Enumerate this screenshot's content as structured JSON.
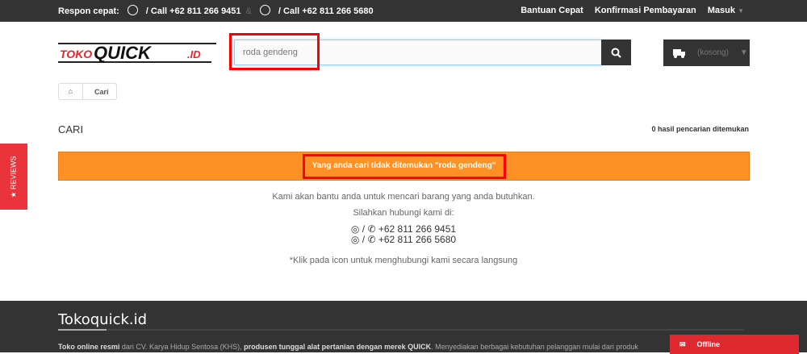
{
  "topbar": {
    "respon": "Respon cepat:",
    "call1": "/ Call +62 811 266 9451",
    "amp": "&",
    "call2": "/ Call +62 811 266 5680",
    "links": [
      "Bantuan Cepat",
      "Konfirmasi Pembayaran",
      "Masuk"
    ]
  },
  "logo": {
    "text": "TOKOQUICK.ID"
  },
  "search": {
    "value": "roda gendeng"
  },
  "cart": {
    "label": "(kosong)"
  },
  "breadcrumb": {
    "current": "Cari"
  },
  "page": {
    "title": "CARI",
    "count": "0 hasil pencarian ditemukan",
    "alert": "Yang anda cari tidak ditemukan \"roda gendeng\"",
    "help1": "Kami akan bantu anda untuk mencari barang yang anda butuhkan.",
    "help2": "Silahkan hubungi kami di:",
    "phone1": "+62 811 266 9451",
    "phone2": "+62 811 266 5680",
    "sep": "/",
    "note": "*Klik pada icon untuk menghubungi kami secara langsung"
  },
  "footer": {
    "title": "Tokoquick.id",
    "b1": "Toko online resmi",
    "t1": " dari CV. Karya Hidup Sentosa (KHS), ",
    "b2": "produsen tunggal alat pertanian dengan merek QUICK",
    "t2": ". Menyediakan berbagai kebutuhan pelanggan mulai dari produk"
  },
  "reviews": {
    "label": "★ REVIEWS"
  },
  "chat": {
    "label": "Offline"
  },
  "colors": {
    "alert": "#fe9126",
    "dark": "#333333",
    "red": "#e0282f"
  }
}
